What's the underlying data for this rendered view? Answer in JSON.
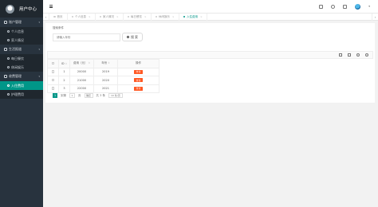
{
  "sidebar": {
    "title": "用户中心",
    "groups": [
      {
        "label": "账户管理",
        "items": [
          {
            "label": "个人信息"
          },
          {
            "label": "家人情况"
          }
        ]
      },
      {
        "label": "生活报道",
        "items": [
          {
            "label": "每日餐饮"
          },
          {
            "label": "休闲娱乐"
          }
        ]
      },
      {
        "label": "收费管理",
        "items": [
          {
            "label": "入住费用"
          },
          {
            "label": "护理费用"
          }
        ]
      }
    ]
  },
  "tabs": [
    {
      "label": "首页"
    },
    {
      "label": "个人信息"
    },
    {
      "label": "家人情况"
    },
    {
      "label": "每日餐饮"
    },
    {
      "label": "休闲娱乐"
    },
    {
      "label": "入住费用"
    }
  ],
  "search": {
    "title": "搜索条件",
    "placeholder": "请输入年份",
    "button_label": "搜 索"
  },
  "table": {
    "columns": [
      "ID",
      "费用（元）",
      "年份",
      "操作"
    ],
    "rows": [
      {
        "id": "1",
        "fee": "20000",
        "year": "2019",
        "action": "支付"
      },
      {
        "id": "2",
        "fee": "21000",
        "year": "2020",
        "action": "支付"
      },
      {
        "id": "3",
        "fee": "22000",
        "year": "2021",
        "action": "支付"
      }
    ]
  },
  "pager": {
    "current": "1",
    "goto_label": "到第",
    "page_value": "1",
    "page_unit": "页",
    "confirm": "确定",
    "total": "共 3 条",
    "per_page": "10 条/页"
  }
}
